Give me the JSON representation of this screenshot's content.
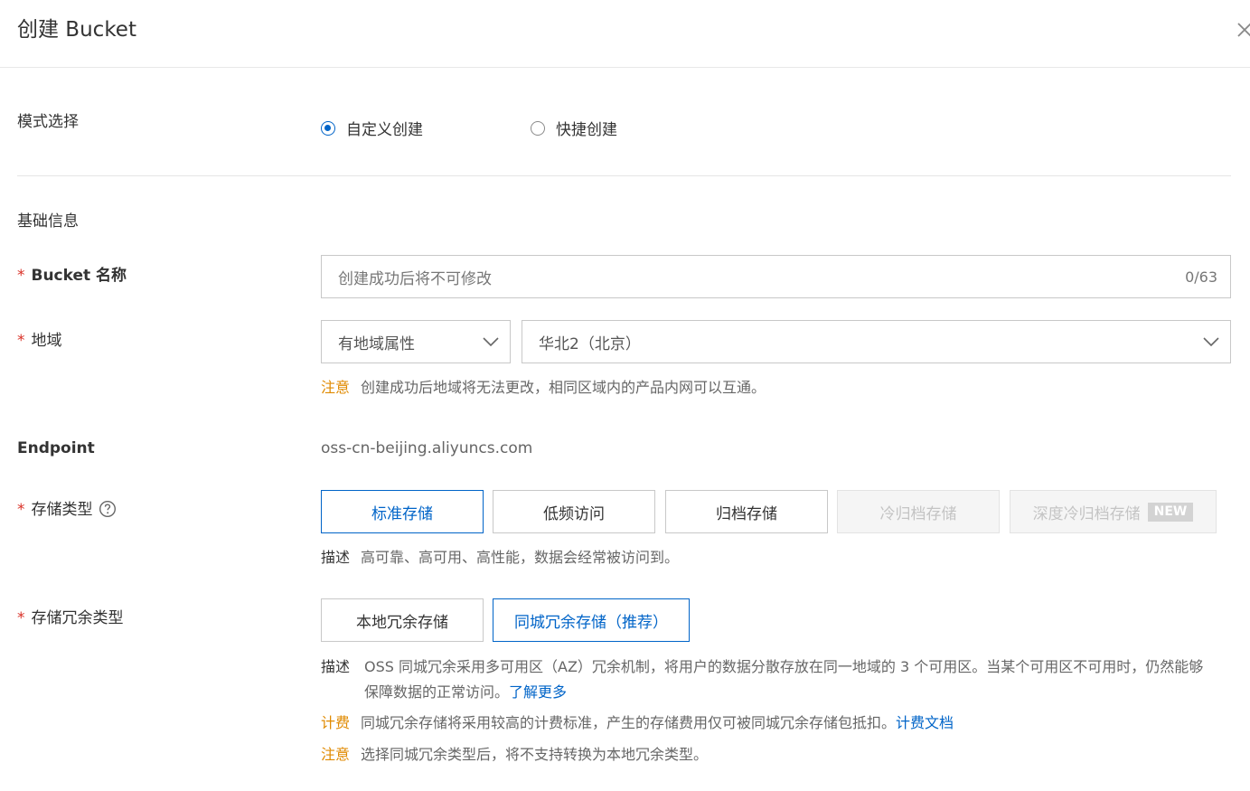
{
  "header": {
    "title": "创建 Bucket",
    "close_icon": "close-icon"
  },
  "mode": {
    "label": "模式选择",
    "options": [
      {
        "label": "自定义创建",
        "checked": true
      },
      {
        "label": "快捷创建",
        "checked": false
      }
    ]
  },
  "basic_info": {
    "title": "基础信息"
  },
  "bucket_name": {
    "required_mark": "*",
    "label": "Bucket 名称",
    "placeholder": "创建成功后将不可修改",
    "counter": "0/63"
  },
  "region": {
    "required_mark": "*",
    "label": "地域",
    "type_value": "有地域属性",
    "region_value": "华北2（北京）",
    "note_key": "注意",
    "note_text": "创建成功后地域将无法更改，相同区域内的产品内网可以互通。"
  },
  "endpoint": {
    "label": "Endpoint",
    "value": "oss-cn-beijing.aliyuncs.com"
  },
  "storage_class": {
    "required_mark": "*",
    "label": "存储类型",
    "help_icon": "question-circle-icon",
    "options": [
      {
        "label": "标准存储",
        "state": "active"
      },
      {
        "label": "低频访问",
        "state": "normal"
      },
      {
        "label": "归档存储",
        "state": "normal"
      },
      {
        "label": "冷归档存储",
        "state": "disabled"
      },
      {
        "label": "深度冷归档存储",
        "state": "disabled",
        "badge": "NEW"
      }
    ],
    "desc_key": "描述",
    "desc_text": "高可靠、高可用、高性能，数据会经常被访问到。"
  },
  "redundancy": {
    "required_mark": "*",
    "label": "存储冗余类型",
    "options": [
      {
        "label": "本地冗余存储",
        "state": "normal"
      },
      {
        "label": "同城冗余存储（推荐）",
        "state": "active"
      }
    ],
    "desc_key": "描述",
    "desc_text": "OSS 同城冗余采用多可用区（AZ）冗余机制，将用户的数据分散存放在同一地域的 3 个可用区。当某个可用区不可用时，仍然能够保障数据的正常访问。",
    "desc_link": "了解更多",
    "billing_key": "计费",
    "billing_text": "同城冗余存储将采用较高的计费标准，产生的存储费用仅可被同城冗余存储包抵扣。",
    "billing_link": "计费文档",
    "note_key": "注意",
    "note_text": "选择同城冗余类型后，将不支持转换为本地冗余类型。"
  },
  "colors": {
    "accent": "#0064c8",
    "warning": "#e08a00",
    "required": "#d93026"
  }
}
